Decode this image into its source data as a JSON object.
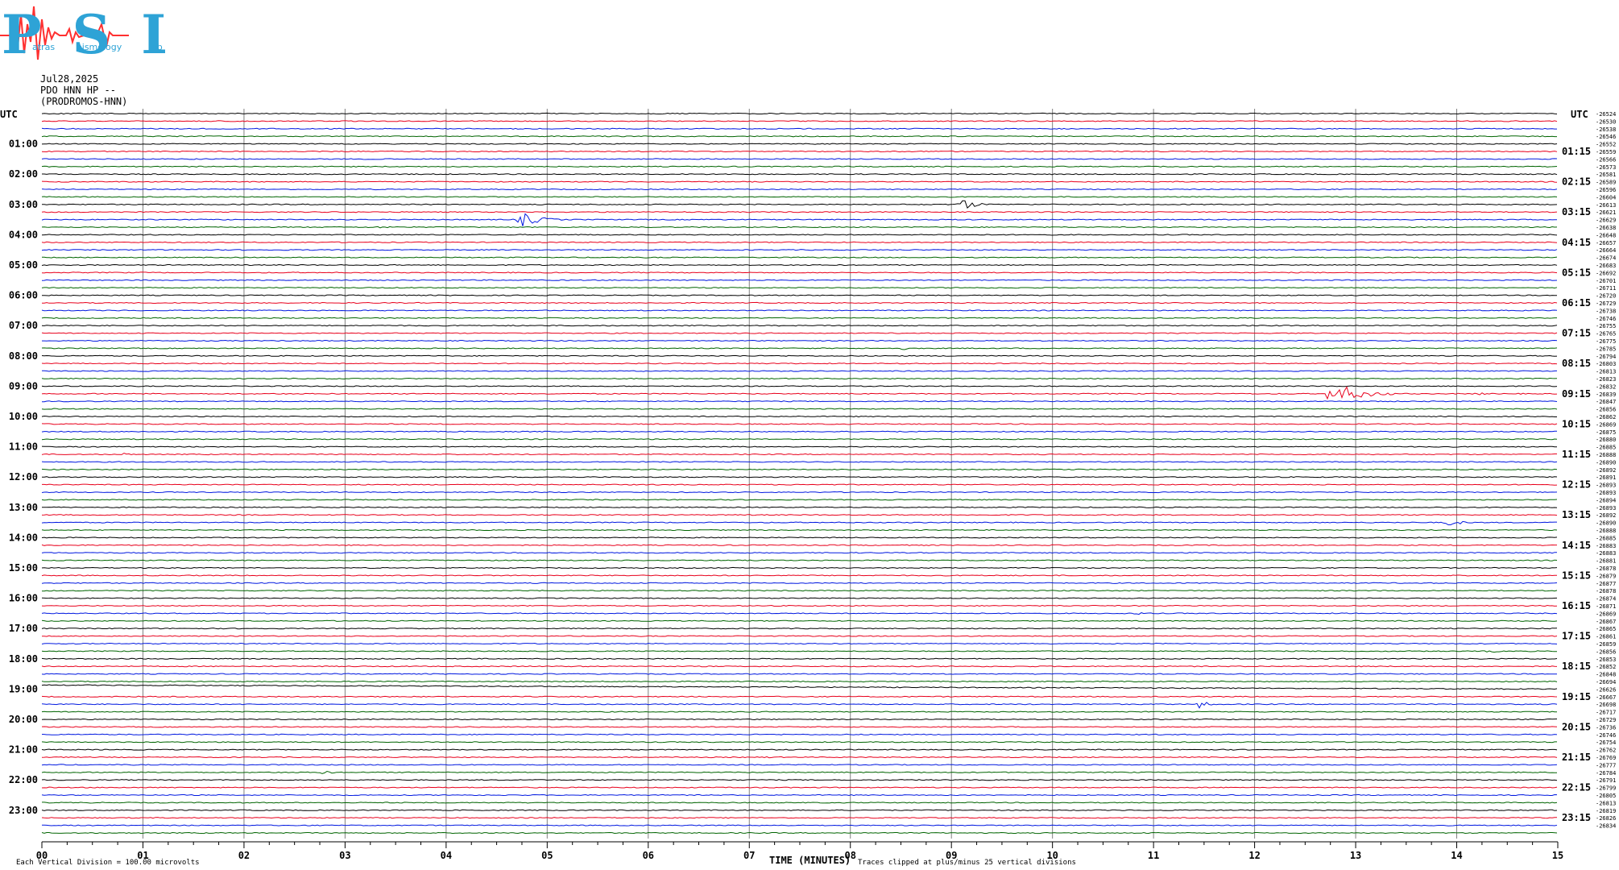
{
  "logo": {
    "text": "PSL",
    "subtext_1": "atras",
    "subtext_2": "eismology",
    "subtext_3": "ab"
  },
  "header": {
    "date": "Jul28,2025",
    "station": "PDO HNN HP --",
    "site": "(PRODROMOS-HNN)"
  },
  "colors": {
    "trace_cycle": [
      "#000000",
      "#e8001c",
      "#0018e0",
      "#006400"
    ],
    "grid": "#808080",
    "logo": "#ff3030",
    "logo_text": "#3399cc"
  },
  "chart_data": {
    "type": "helicorder",
    "left_axis_title": "UTC",
    "right_axis_title": "UTC",
    "left_hour_labels": [
      "01:00",
      "02:00",
      "03:00",
      "04:00",
      "05:00",
      "06:00",
      "07:00",
      "08:00",
      "09:00",
      "10:00",
      "11:00",
      "12:00",
      "13:00",
      "14:00",
      "15:00",
      "16:00",
      "17:00",
      "18:00",
      "19:00",
      "20:00",
      "21:00",
      "22:00",
      "23:00"
    ],
    "right_hour_labels": [
      "01:15",
      "02:15",
      "03:15",
      "04:15",
      "05:15",
      "06:15",
      "07:15",
      "08:15",
      "09:15",
      "10:15",
      "11:15",
      "12:15",
      "13:15",
      "14:15",
      "15:15",
      "16:15",
      "17:15",
      "18:15",
      "19:15",
      "20:15",
      "21:15",
      "22:15",
      "23:15"
    ],
    "x_tick_labels": [
      "00",
      "01",
      "02",
      "03",
      "04",
      "05",
      "06",
      "07",
      "08",
      "09",
      "10",
      "11",
      "12",
      "13",
      "14",
      "15"
    ],
    "xlabel": "TIME (MINUTES)",
    "xlim": [
      0,
      15
    ],
    "minutes_per_line": 15,
    "line_count": 96,
    "line_offsets": [
      "-26524",
      "-26530",
      "-26538",
      "-26546",
      "-26552",
      "-26559",
      "-26566",
      "-26573",
      "-26581",
      "-26589",
      "-26596",
      "-26604",
      "-26613",
      "-26621",
      "-26629",
      "-26638",
      "-26648",
      "-26657",
      "-26664",
      "-26674",
      "-26683",
      "-26692",
      "-26701",
      "-26711",
      "-26720",
      "-26729",
      "-26738",
      "-26746",
      "-26755",
      "-26765",
      "-26775",
      "-26785",
      "-26794",
      "-26803",
      "-26813",
      "-26823",
      "-26832",
      "-26839",
      "-26847",
      "-26856",
      "-26862",
      "-26869",
      "-26875",
      "-26880",
      "-26885",
      "-26888",
      "-26890",
      "-26892",
      "-26891",
      "-26893",
      "-26893",
      "-26894",
      "-26893",
      "-26892",
      "-26890",
      "-26888",
      "-26885",
      "-26883",
      "-26883",
      "-26881",
      "-26878",
      "-26879",
      "-26877",
      "-26878",
      "-26874",
      "-26871",
      "-26869",
      "-26867",
      "-26865",
      "-26861",
      "-26859",
      "-26856",
      "-26853",
      "-26852",
      "-26848",
      "-26694",
      "-26626",
      "-26667",
      "-26698",
      "-26717",
      "-26729",
      "-26736",
      "-26746",
      "-26754",
      "-26762",
      "-26769",
      "-26777",
      "-26784",
      "-26791",
      "-26799",
      "-26805",
      "-26813",
      "-26819",
      "-26826",
      "-26834"
    ],
    "events": [
      {
        "line": 12,
        "minute": 9.1,
        "amplitude": 10,
        "duration": 0.35
      },
      {
        "line": 14,
        "minute": 4.75,
        "amplitude": 12,
        "duration": 0.45
      },
      {
        "line": 15,
        "minute": 3.35,
        "amplitude": 3,
        "duration": 0.3
      },
      {
        "line": 21,
        "minute": 5.3,
        "amplitude": 2,
        "duration": 0.2
      },
      {
        "line": 31,
        "minute": 8.5,
        "amplitude": 3,
        "duration": 0.25
      },
      {
        "line": 37,
        "minute": 12.75,
        "amplitude": 20,
        "duration": 0.7
      },
      {
        "line": 37,
        "minute": 14.2,
        "amplitude": 3,
        "duration": 0.2
      },
      {
        "line": 42,
        "minute": 8.5,
        "amplitude": 2,
        "duration": 0.2
      },
      {
        "line": 45,
        "minute": 0.8,
        "amplitude": 4,
        "duration": 0.15
      },
      {
        "line": 54,
        "minute": 13.9,
        "amplitude": 5,
        "duration": 0.45
      },
      {
        "line": 66,
        "minute": 10.8,
        "amplitude": 2,
        "duration": 0.6
      },
      {
        "line": 71,
        "minute": 14.3,
        "amplitude": 3,
        "duration": 0.3
      },
      {
        "line": 78,
        "minute": 11.45,
        "amplitude": 6,
        "duration": 0.3
      },
      {
        "line": 85,
        "minute": 7.2,
        "amplitude": 3,
        "duration": 0.15
      },
      {
        "line": 87,
        "minute": 2.75,
        "amplitude": 3,
        "duration": 0.4
      }
    ],
    "drift": {
      "line": 76,
      "start_minute": 0,
      "end_minute": 15,
      "offset_divisions": 5
    },
    "footer_left": "Each Vertical Division =  100.00 microvolts",
    "footer_right": "Traces clipped at plus/minus 25 vertical divisions"
  }
}
